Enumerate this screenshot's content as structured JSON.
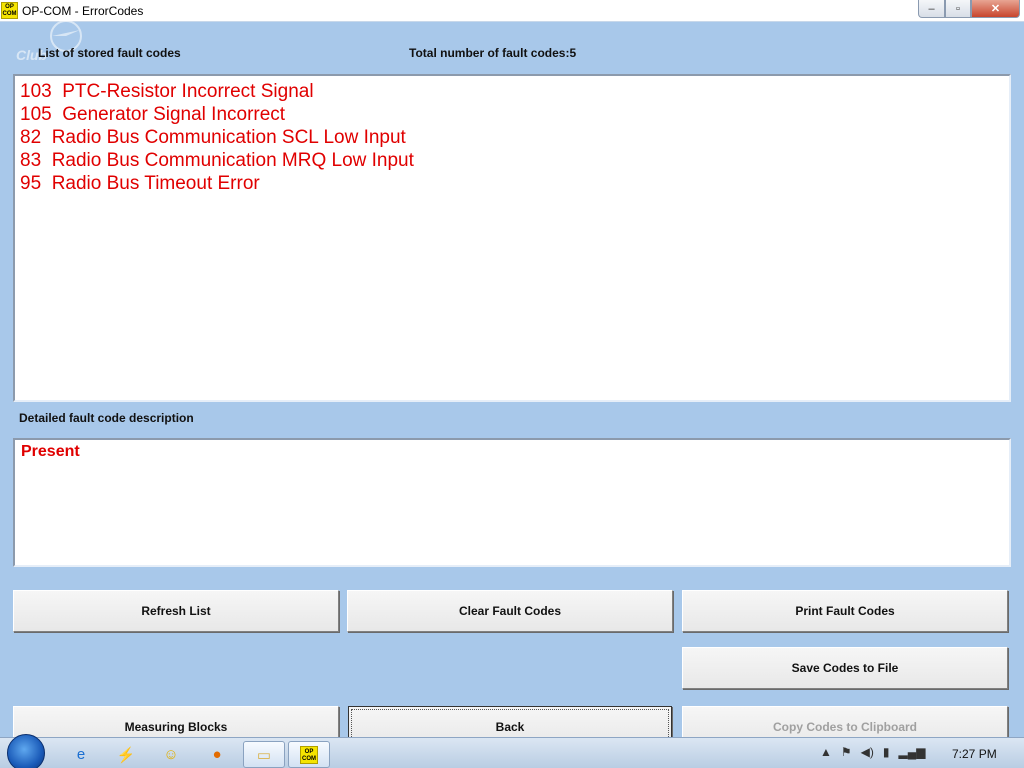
{
  "window": {
    "title": "OP-COM - ErrorCodes",
    "icon_text": "OP COM",
    "controls": {
      "minimize": "–",
      "maximize": "▫",
      "close": "✕"
    },
    "watermark_text": "Club"
  },
  "fault_section": {
    "label": "List of stored fault codes",
    "total_label": "Total number of fault codes:5",
    "items": [
      "103  PTC-Resistor Incorrect Signal",
      "105  Generator Signal Incorrect",
      "82  Radio Bus Communication SCL Low Input",
      "83  Radio Bus Communication MRQ Low Input",
      "95  Radio Bus Timeout Error"
    ]
  },
  "detail_section": {
    "label": "Detailed fault code description",
    "text": "Present"
  },
  "buttons": {
    "refresh": "Refresh List",
    "clear": "Clear Fault Codes",
    "print": "Print Fault Codes",
    "save": "Save Codes to File",
    "measuring": "Measuring Blocks",
    "back": "Back",
    "copy": "Copy Codes to Clipboard"
  },
  "taskbar": {
    "items": [
      "internet-explorer-icon",
      "run-icon",
      "messenger-icon",
      "firefox-icon",
      "explorer-icon",
      "opcom-icon"
    ],
    "opcom_text": "OP COM",
    "clock": "7:27 PM"
  },
  "colors": {
    "background": "#a8c8ea",
    "fault_text": "#e00000",
    "disabled_text": "#a0a0a0"
  }
}
